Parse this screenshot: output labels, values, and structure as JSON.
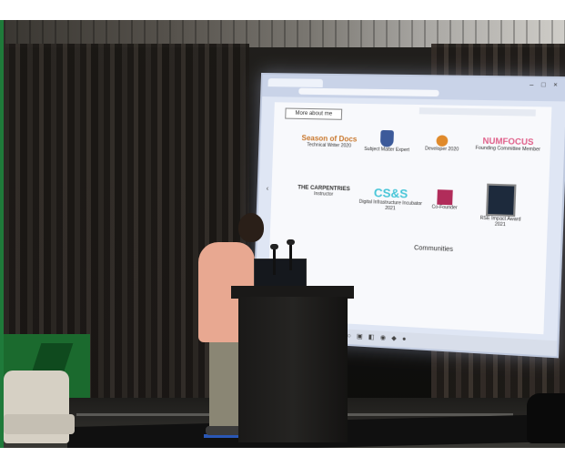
{
  "slide": {
    "section_title": "More about me",
    "logos": [
      {
        "mark": "Season of Docs",
        "caption": "Technical Writer 2020"
      },
      {
        "mark": "",
        "caption": "Subject Matter Expert"
      },
      {
        "mark": "",
        "caption": "Developer 2020"
      },
      {
        "mark": "NUMFOCUS",
        "caption": "Founding Committee Member"
      },
      {
        "mark": "THE CARPENTRIES",
        "caption": "Instructor"
      },
      {
        "mark": "CS&S",
        "caption": "Digital Infrastructure Incubator 2021"
      },
      {
        "mark": "",
        "caption": "Co-Founder"
      },
      {
        "mark": "",
        "caption": "RSE Impact Award 2021"
      }
    ],
    "subheading": "Communities"
  },
  "colors": {
    "accent_green": "#1f7a3a",
    "screen_glow": "#dfe6f4",
    "speaker_top": "#e8a891"
  }
}
